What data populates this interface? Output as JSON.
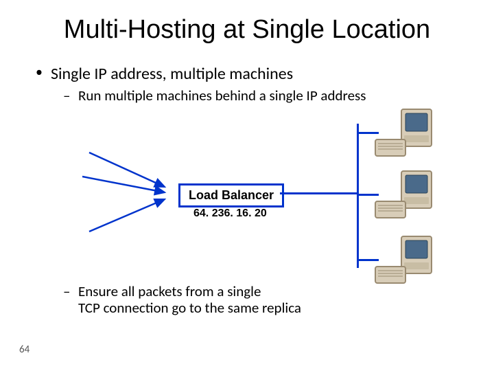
{
  "title": "Multi-Hosting at Single Location",
  "bullets": {
    "l1": "Single IP address, multiple machines",
    "l2a": "Run multiple machines behind a single IP address",
    "l2b_line1": "Ensure all packets from a single",
    "l2b_line2": "TCP connection go to the same replica"
  },
  "diagram": {
    "box_label": "Load Balancer",
    "ip": "64. 236. 16. 20"
  },
  "slide_number": "64"
}
